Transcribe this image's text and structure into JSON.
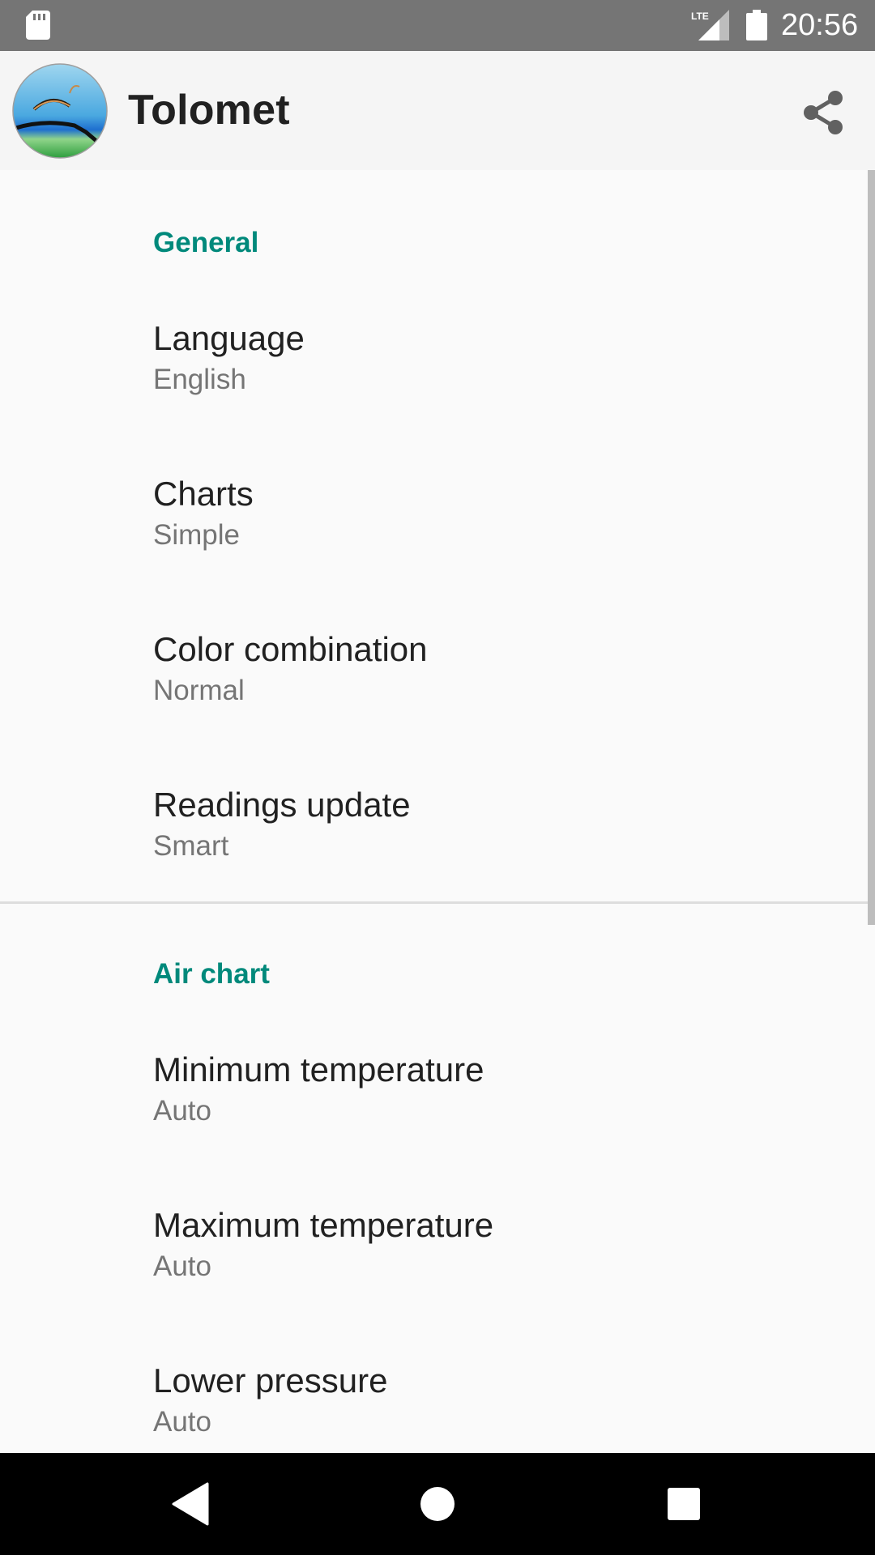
{
  "status_bar": {
    "time": "20:56",
    "network_label": "LTE",
    "icons": [
      "sd-card-icon",
      "lte-signal-icon",
      "battery-icon"
    ]
  },
  "app_bar": {
    "title": "Tolomet",
    "logo_icon": "tolomet-logo-icon",
    "share_icon": "share-icon"
  },
  "sections": [
    {
      "header": "General",
      "items": [
        {
          "title": "Language",
          "summary": "English"
        },
        {
          "title": "Charts",
          "summary": "Simple"
        },
        {
          "title": "Color combination",
          "summary": "Normal"
        },
        {
          "title": "Readings update",
          "summary": "Smart"
        }
      ]
    },
    {
      "header": "Air chart",
      "items": [
        {
          "title": "Minimum temperature",
          "summary": "Auto"
        },
        {
          "title": "Maximum temperature",
          "summary": "Auto"
        },
        {
          "title": "Lower pressure",
          "summary": "Auto"
        }
      ]
    }
  ],
  "nav_bar": {
    "icons": [
      "back-icon",
      "home-icon",
      "recents-icon"
    ]
  },
  "colors": {
    "accent": "#00897b",
    "status_bar": "#757575",
    "app_bar": "#f5f5f5",
    "background": "#fafafa",
    "primary_text": "#212121",
    "secondary_text": "#757575"
  }
}
